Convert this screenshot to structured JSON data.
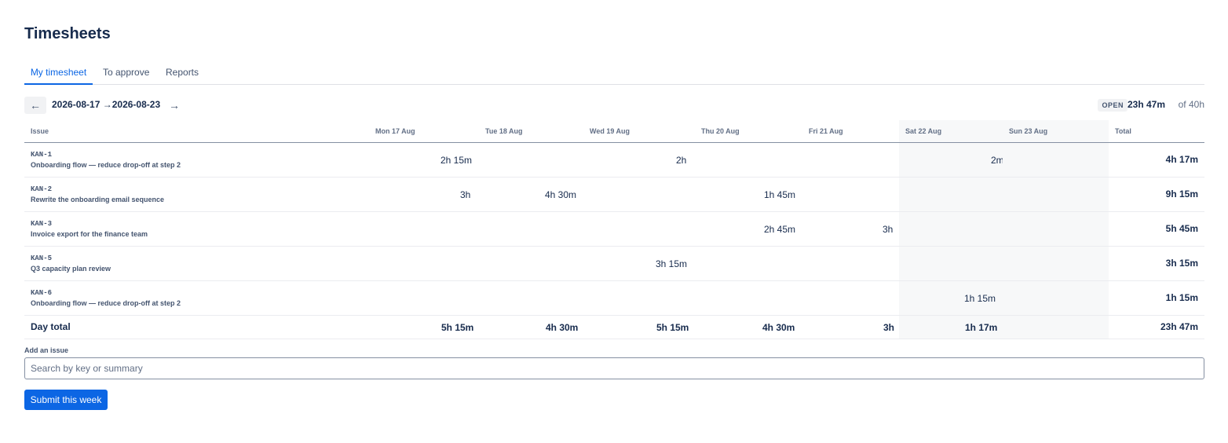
{
  "page": {
    "title": "Timesheets"
  },
  "tabs": [
    {
      "label": "My timesheet",
      "active": true
    },
    {
      "label": "To approve",
      "active": false
    },
    {
      "label": "Reports",
      "active": false
    }
  ],
  "week_nav": {
    "prev_icon": "←",
    "next_icon": "→",
    "start": "2026-08-17",
    "separator": "→",
    "end": "2026-08-23"
  },
  "status": {
    "badge": "OPEN",
    "logged": "23h 47m",
    "target": "of 40h"
  },
  "table": {
    "headers": {
      "issue": "Issue",
      "days": [
        "Mon 17 Aug",
        "Tue 18 Aug",
        "Wed 19 Aug",
        "Thu 20 Aug",
        "Fri 21 Aug",
        "Sat 22 Aug",
        "Sun 23 Aug"
      ],
      "total": "Total"
    },
    "rows": [
      {
        "key": "KAN-1",
        "summary": "Onboarding flow — reduce drop-off at step 2",
        "cells": [
          "2h 15m",
          "",
          "2h",
          "",
          "",
          "2m",
          ""
        ],
        "total": "4h 17m"
      },
      {
        "key": "KAN-2",
        "summary": "Rewrite the onboarding email sequence",
        "cells": [
          "3h",
          "4h 30m",
          "",
          "1h 45m",
          "",
          "",
          ""
        ],
        "total": "9h 15m"
      },
      {
        "key": "KAN-3",
        "summary": "Invoice export for the finance team",
        "cells": [
          "",
          "",
          "",
          "2h 45m",
          "3h",
          "",
          ""
        ],
        "total": "5h 45m"
      },
      {
        "key": "KAN-5",
        "summary": "Q3 capacity plan review",
        "cells": [
          "",
          "",
          "3h 15m",
          "",
          "",
          "",
          ""
        ],
        "total": "3h 15m"
      },
      {
        "key": "KAN-6",
        "summary": "Onboarding flow — reduce drop-off at step 2",
        "cells": [
          "",
          "",
          "",
          "",
          "",
          "1h 15m",
          ""
        ],
        "total": "1h 15m"
      }
    ],
    "day_total": {
      "label": "Day total",
      "cells": [
        "5h 15m",
        "4h 30m",
        "5h 15m",
        "4h 30m",
        "3h",
        "1h 17m",
        ""
      ],
      "total": "23h 47m"
    }
  },
  "add_issue": {
    "label": "Add an issue",
    "placeholder": "Search by key or summary"
  },
  "submit": {
    "label": "Submit this week"
  }
}
